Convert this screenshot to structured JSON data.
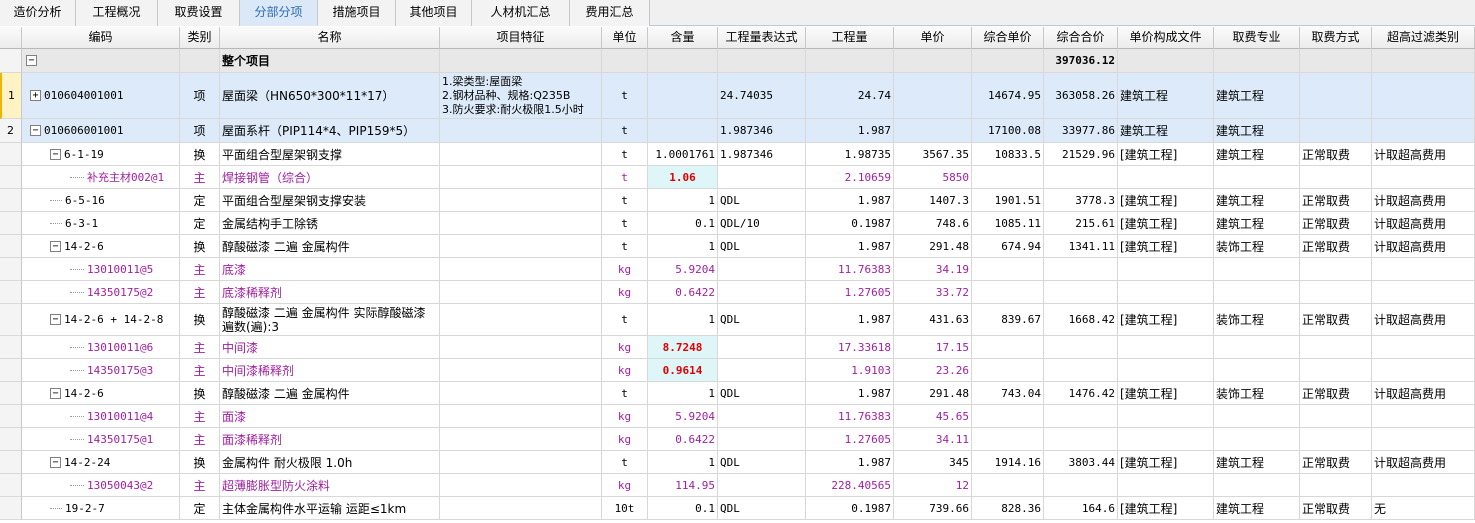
{
  "tabs": [
    {
      "label": "造价分析",
      "active": false
    },
    {
      "label": "工程概况",
      "active": false
    },
    {
      "label": "取费设置",
      "active": false
    },
    {
      "label": "分部分项",
      "active": true
    },
    {
      "label": "措施项目",
      "active": false
    },
    {
      "label": "其他项目",
      "active": false
    },
    {
      "label": "人材机汇总",
      "active": false
    },
    {
      "label": "费用汇总",
      "active": false
    }
  ],
  "columns": [
    "编码",
    "类别",
    "名称",
    "项目特征",
    "单位",
    "含量",
    "工程量表达式",
    "工程量",
    "单价",
    "综合单价",
    "综合合价",
    "单价构成文件",
    "取费专业",
    "取费方式",
    "超高过滤类别"
  ],
  "colors": {
    "main_material": "#a020a0",
    "highlight_bg": "#dff6f9",
    "highlight_text": "#e00000",
    "selected_row_bg": "#dceaf9",
    "total_row_bg": "#e8e8e8"
  },
  "rows": [
    {
      "num": "",
      "kind": "total",
      "depth": 0,
      "expand": "minus",
      "code": "",
      "cat": "",
      "name": "整个项目",
      "feature": "",
      "unit": "",
      "qty_content": "",
      "expr": "",
      "qty": "",
      "price": "",
      "comp_price": "",
      "comp_total": "397036.12",
      "file": "",
      "major": "",
      "method": "",
      "filter": ""
    },
    {
      "num": "1",
      "kind": "item",
      "depth": 0,
      "expand": "plus",
      "code": "010604001001",
      "cat": "项",
      "name": "屋面梁（HN650*300*11*17）",
      "feature": "1.梁类型:屋面梁\n2.钢材品种、规格:Q235B\n3.防火要求:耐火极限1.5小时",
      "unit": "t",
      "qty_content": "",
      "expr": "24.74035",
      "qty": "24.74",
      "price": "",
      "comp_price": "14674.95",
      "comp_total": "363058.26",
      "file": "建筑工程",
      "major": "建筑工程",
      "method": "",
      "filter": ""
    },
    {
      "num": "2",
      "kind": "item",
      "depth": 0,
      "expand": "minus",
      "code": "010606001001",
      "cat": "项",
      "name": "屋面系杆（PIP114*4、PIP159*5）",
      "feature": "",
      "unit": "t",
      "qty_content": "",
      "expr": "1.987346",
      "qty": "1.987",
      "price": "",
      "comp_price": "17100.08",
      "comp_total": "33977.86",
      "file": "建筑工程",
      "major": "建筑工程",
      "method": "",
      "filter": ""
    },
    {
      "num": "",
      "kind": "quota",
      "depth": 1,
      "expand": "minus",
      "code": "6-1-19",
      "cat": "换",
      "name": "平面组合型屋架钢支撑",
      "feature": "",
      "unit": "t",
      "qty_content": "1.0001761",
      "expr": "1.987346",
      "qty": "1.98735",
      "price": "3567.35",
      "comp_price": "10833.5",
      "comp_total": "21529.96",
      "file": "[建筑工程]",
      "major": "建筑工程",
      "method": "正常取费",
      "filter": "计取超高费用"
    },
    {
      "num": "",
      "kind": "main",
      "depth": 2,
      "expand": "",
      "code": "补充主材002@1",
      "cat": "主",
      "name": "焊接钢管（综合）",
      "feature": "",
      "unit": "t",
      "qty_content": "1.06",
      "hl": true,
      "expr": "",
      "qty": "2.10659",
      "price": "5850",
      "comp_price": "",
      "comp_total": "",
      "file": "",
      "major": "",
      "method": "",
      "filter": ""
    },
    {
      "num": "",
      "kind": "quota",
      "depth": 1,
      "expand": "",
      "code": "6-5-16",
      "cat": "定",
      "name": "平面组合型屋架钢支撑安装",
      "feature": "",
      "unit": "t",
      "qty_content": "1",
      "expr": "QDL",
      "qty": "1.987",
      "price": "1407.3",
      "comp_price": "1901.51",
      "comp_total": "3778.3",
      "file": "[建筑工程]",
      "major": "建筑工程",
      "method": "正常取费",
      "filter": "计取超高费用"
    },
    {
      "num": "",
      "kind": "quota",
      "depth": 1,
      "expand": "",
      "code": "6-3-1",
      "cat": "定",
      "name": "金属结构手工除锈",
      "feature": "",
      "unit": "t",
      "qty_content": "0.1",
      "expr": "QDL/10",
      "qty": "0.1987",
      "price": "748.6",
      "comp_price": "1085.11",
      "comp_total": "215.61",
      "file": "[建筑工程]",
      "major": "建筑工程",
      "method": "正常取费",
      "filter": "计取超高费用"
    },
    {
      "num": "",
      "kind": "quota",
      "depth": 1,
      "expand": "minus",
      "code": "14-2-6",
      "cat": "换",
      "name": "醇酸磁漆 二遍 金属构件",
      "feature": "",
      "unit": "t",
      "qty_content": "1",
      "expr": "QDL",
      "qty": "1.987",
      "price": "291.48",
      "comp_price": "674.94",
      "comp_total": "1341.11",
      "file": "[建筑工程]",
      "major": "装饰工程",
      "method": "正常取费",
      "filter": "计取超高费用"
    },
    {
      "num": "",
      "kind": "main",
      "depth": 2,
      "expand": "",
      "code": "13010011@5",
      "cat": "主",
      "name": "底漆",
      "feature": "",
      "unit": "kg",
      "qty_content": "5.9204",
      "expr": "",
      "qty": "11.76383",
      "price": "34.19",
      "comp_price": "",
      "comp_total": "",
      "file": "",
      "major": "",
      "method": "",
      "filter": ""
    },
    {
      "num": "",
      "kind": "main",
      "depth": 2,
      "expand": "",
      "code": "14350175@2",
      "cat": "主",
      "name": "底漆稀释剂",
      "feature": "",
      "unit": "kg",
      "qty_content": "0.6422",
      "expr": "",
      "qty": "1.27605",
      "price": "33.72",
      "comp_price": "",
      "comp_total": "",
      "file": "",
      "major": "",
      "method": "",
      "filter": ""
    },
    {
      "num": "",
      "kind": "quota",
      "depth": 1,
      "expand": "minus",
      "code": "14-2-6 + 14-2-8",
      "cat": "换",
      "name": "醇酸磁漆 二遍 金属构件  实际醇酸磁漆\n遍数(遍):3",
      "feature": "",
      "unit": "t",
      "qty_content": "1",
      "expr": "QDL",
      "qty": "1.987",
      "price": "431.63",
      "comp_price": "839.67",
      "comp_total": "1668.42",
      "file": "[建筑工程]",
      "major": "装饰工程",
      "method": "正常取费",
      "filter": "计取超高费用"
    },
    {
      "num": "",
      "kind": "main",
      "depth": 2,
      "expand": "",
      "code": "13010011@6",
      "cat": "主",
      "name": "中间漆",
      "feature": "",
      "unit": "kg",
      "qty_content": "8.7248",
      "hl": true,
      "expr": "",
      "qty": "17.33618",
      "price": "17.15",
      "comp_price": "",
      "comp_total": "",
      "file": "",
      "major": "",
      "method": "",
      "filter": ""
    },
    {
      "num": "",
      "kind": "main",
      "depth": 2,
      "expand": "",
      "code": "14350175@3",
      "cat": "主",
      "name": "中间漆稀释剂",
      "feature": "",
      "unit": "kg",
      "qty_content": "0.9614",
      "hl": true,
      "expr": "",
      "qty": "1.9103",
      "price": "23.26",
      "comp_price": "",
      "comp_total": "",
      "file": "",
      "major": "",
      "method": "",
      "filter": ""
    },
    {
      "num": "",
      "kind": "quota",
      "depth": 1,
      "expand": "minus",
      "code": "14-2-6",
      "cat": "换",
      "name": "醇酸磁漆 二遍 金属构件",
      "feature": "",
      "unit": "t",
      "qty_content": "1",
      "expr": "QDL",
      "qty": "1.987",
      "price": "291.48",
      "comp_price": "743.04",
      "comp_total": "1476.42",
      "file": "[建筑工程]",
      "major": "装饰工程",
      "method": "正常取费",
      "filter": "计取超高费用"
    },
    {
      "num": "",
      "kind": "main",
      "depth": 2,
      "expand": "",
      "code": "13010011@4",
      "cat": "主",
      "name": "面漆",
      "feature": "",
      "unit": "kg",
      "qty_content": "5.9204",
      "expr": "",
      "qty": "11.76383",
      "price": "45.65",
      "comp_price": "",
      "comp_total": "",
      "file": "",
      "major": "",
      "method": "",
      "filter": ""
    },
    {
      "num": "",
      "kind": "main",
      "depth": 2,
      "expand": "",
      "code": "14350175@1",
      "cat": "主",
      "name": "面漆稀释剂",
      "feature": "",
      "unit": "kg",
      "qty_content": "0.6422",
      "expr": "",
      "qty": "1.27605",
      "price": "34.11",
      "comp_price": "",
      "comp_total": "",
      "file": "",
      "major": "",
      "method": "",
      "filter": ""
    },
    {
      "num": "",
      "kind": "quota",
      "depth": 1,
      "expand": "minus",
      "code": "14-2-24",
      "cat": "换",
      "name": "金属构件 耐火极限 1.0h",
      "feature": "",
      "unit": "t",
      "qty_content": "1",
      "expr": "QDL",
      "qty": "1.987",
      "price": "345",
      "comp_price": "1914.16",
      "comp_total": "3803.44",
      "file": "[建筑工程]",
      "major": "建筑工程",
      "method": "正常取费",
      "filter": "计取超高费用"
    },
    {
      "num": "",
      "kind": "main",
      "depth": 2,
      "expand": "",
      "code": "13050043@2",
      "cat": "主",
      "name": "超薄膨胀型防火涂料",
      "feature": "",
      "unit": "kg",
      "qty_content": "114.95",
      "expr": "",
      "qty": "228.40565",
      "price": "12",
      "comp_price": "",
      "comp_total": "",
      "file": "",
      "major": "",
      "method": "",
      "filter": ""
    },
    {
      "num": "",
      "kind": "quota",
      "depth": 1,
      "expand": "",
      "code": "19-2-7",
      "cat": "定",
      "name": "主体金属构件水平运输 运距≤1km",
      "feature": "",
      "unit": "10t",
      "qty_content": "0.1",
      "expr": "QDL",
      "qty": "0.1987",
      "price": "739.66",
      "comp_price": "828.36",
      "comp_total": "164.6",
      "file": "[建筑工程]",
      "major": "建筑工程",
      "method": "正常取费",
      "filter": "无"
    }
  ]
}
